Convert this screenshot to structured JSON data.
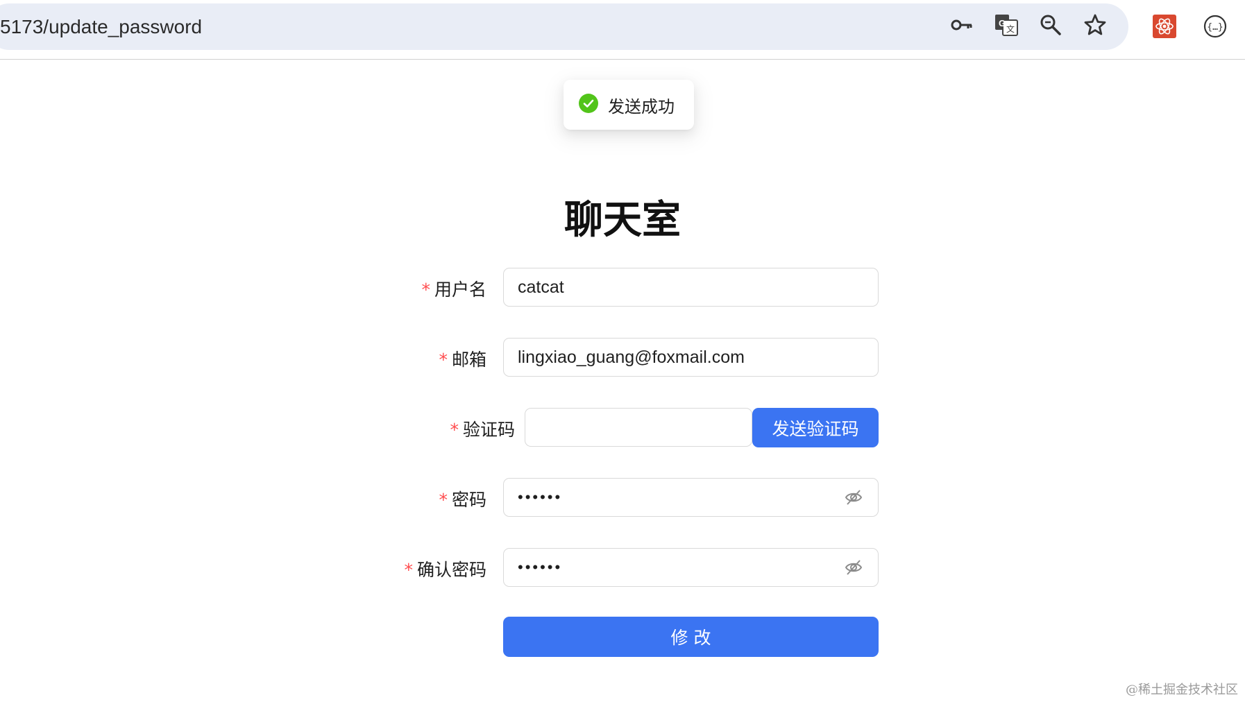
{
  "browser": {
    "url": "5173/update_password",
    "icons": [
      "key-icon",
      "translate-icon",
      "zoom-icon",
      "bookmark-star-icon"
    ],
    "extensions": [
      "react-devtools-extension-icon",
      "json-viewer-extension-icon"
    ]
  },
  "toast": {
    "text": "发送成功",
    "icon": "check-circle-icon",
    "color": "#52c41a"
  },
  "page": {
    "title": "聊天室"
  },
  "form": {
    "required_mark": "*",
    "username": {
      "label": "用户名",
      "value": "catcat"
    },
    "email": {
      "label": "邮箱",
      "value": "lingxiao_guang@foxmail.com"
    },
    "captcha": {
      "label": "验证码",
      "value": "",
      "button": "发送验证码"
    },
    "password": {
      "label": "密码",
      "value": "••••••"
    },
    "confirm_password": {
      "label": "确认密码",
      "value": "••••••"
    },
    "submit": "修 改"
  },
  "colors": {
    "primary": "#3b74f2",
    "required": "#ff4d4f"
  },
  "watermark": "@稀土掘金技术社区"
}
